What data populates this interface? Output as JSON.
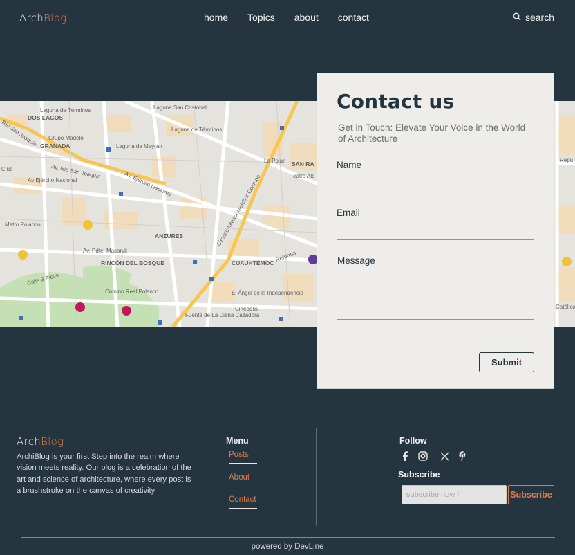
{
  "header": {
    "logo_main": "Arch",
    "logo_accent": "Blog",
    "nav": [
      "home",
      "Topics",
      "about",
      "contact"
    ],
    "search_label": "search"
  },
  "map": {
    "labels": [
      "Laguna de Términos",
      "DOS LAGOS",
      "Grupo Modelo",
      "GRANADA",
      "Laguna de Mayrán",
      "Av. Río San Joaquín",
      "Av Ejército Nacional",
      "Río San Joaquín",
      "Club",
      "Metro Polanco",
      "Laguna San Cristóbal",
      "Laguna de Términos",
      "La Polar",
      "SAN RA",
      "Teatro Ald",
      "ANZURES",
      "RINCÓN DEL BOSQUE",
      "Camino Real Polanco",
      "CUAUHTÉMOC",
      "El Ángel de la Independencia",
      "Cinépolis",
      "Fuente de La Diana Cazadora",
      "Av. Pdte. Masaryk",
      "Calle 3 Picos",
      "Av. Ejército Nacional",
      "Circuito Interior Melchor Ocampo",
      "Reforma",
      "Católica",
      "Repu"
    ]
  },
  "contact": {
    "title": "Contact us",
    "subtitle": "Get in Touch: Elevate Your Voice in the World of Architecture",
    "name_label": "Name",
    "email_label": "Email",
    "message_label": "Message",
    "submit_label": "Submit"
  },
  "footer": {
    "logo_main": "Arch",
    "logo_accent": "Blog",
    "about": "ArchiBlog is your first Step into the realm where vision meets reality. Our blog is a celebration of the art and science of architecture, where every post is a brushstroke on the canvas of creativity",
    "menu_title": "Menu",
    "menu": [
      "Posts",
      "About",
      "Contact"
    ],
    "follow_title": "Follow",
    "socials": [
      "facebook-icon",
      "instagram-icon",
      "x-icon",
      "pinterest-icon"
    ],
    "subscribe_title": "Subscribe",
    "subscribe_placeholder": "subscribe now !",
    "subscribe_button": "Subscribe",
    "powered": "powered by DevLine"
  },
  "colors": {
    "background": "#253540",
    "accent": "#e2794a",
    "card": "#eeede9"
  }
}
